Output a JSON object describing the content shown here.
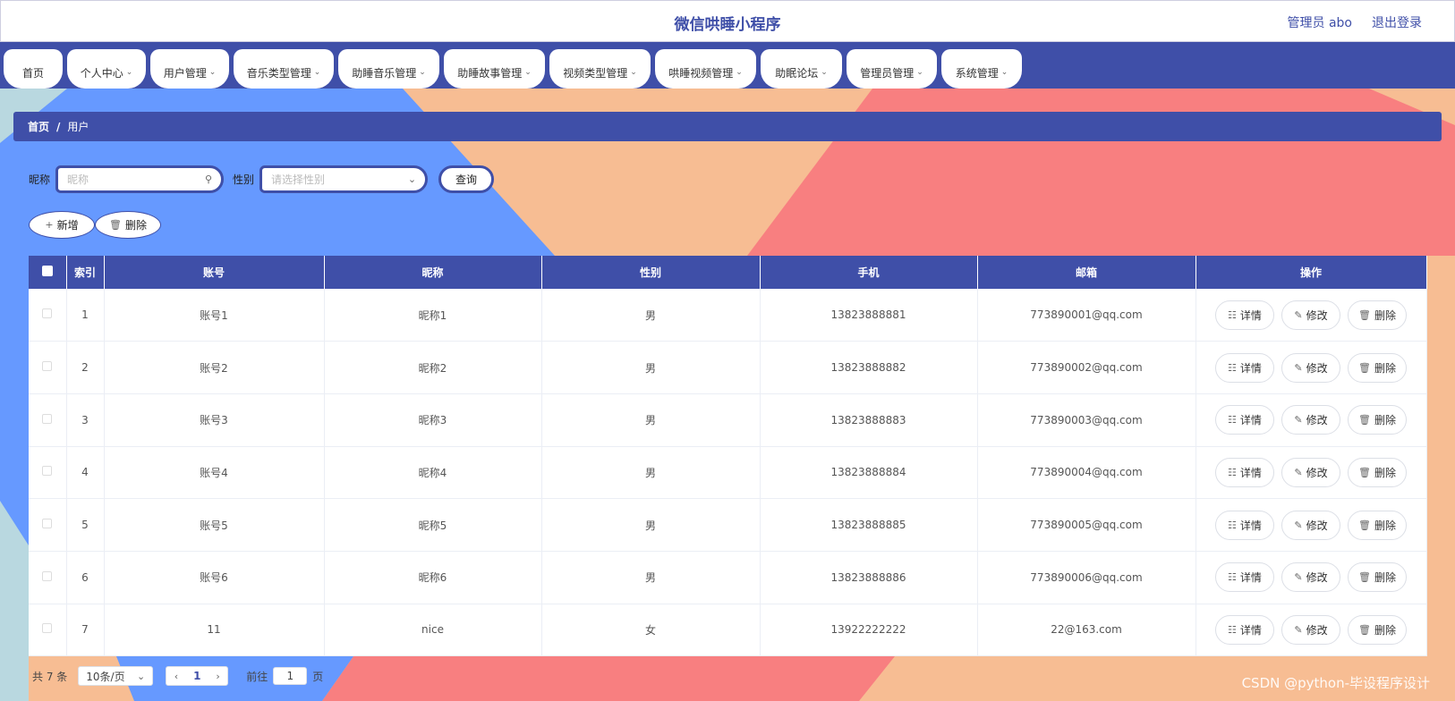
{
  "header": {
    "app_title": "微信哄睡小程序",
    "user_label": "管理员 abo",
    "logout_label": "退出登录"
  },
  "nav": {
    "tabs": [
      {
        "label": "首页",
        "has_dropdown": false
      },
      {
        "label": "个人中心",
        "has_dropdown": true
      },
      {
        "label": "用户管理",
        "has_dropdown": true
      },
      {
        "label": "音乐类型管理",
        "has_dropdown": true
      },
      {
        "label": "助睡音乐管理",
        "has_dropdown": true
      },
      {
        "label": "助睡故事管理",
        "has_dropdown": true
      },
      {
        "label": "视频类型管理",
        "has_dropdown": true
      },
      {
        "label": "哄睡视频管理",
        "has_dropdown": true
      },
      {
        "label": "助眠论坛",
        "has_dropdown": true
      },
      {
        "label": "管理员管理",
        "has_dropdown": true
      },
      {
        "label": "系统管理",
        "has_dropdown": true
      }
    ]
  },
  "breadcrumb": {
    "home": "首页",
    "separator": "/",
    "current": "用户"
  },
  "search": {
    "nickname_label": "昵称",
    "nickname_placeholder": "昵称",
    "gender_label": "性别",
    "gender_placeholder": "请选择性别",
    "query_label": "查询"
  },
  "actions": {
    "add_label": "新增",
    "delete_label": "删除"
  },
  "table": {
    "columns": [
      "索引",
      "账号",
      "昵称",
      "性别",
      "手机",
      "邮箱",
      "操作"
    ],
    "rows": [
      {
        "index": "1",
        "account": "账号1",
        "nickname": "昵称1",
        "gender": "男",
        "phone": "13823888881",
        "email": "773890001@qq.com"
      },
      {
        "index": "2",
        "account": "账号2",
        "nickname": "昵称2",
        "gender": "男",
        "phone": "13823888882",
        "email": "773890002@qq.com"
      },
      {
        "index": "3",
        "account": "账号3",
        "nickname": "昵称3",
        "gender": "男",
        "phone": "13823888883",
        "email": "773890003@qq.com"
      },
      {
        "index": "4",
        "account": "账号4",
        "nickname": "昵称4",
        "gender": "男",
        "phone": "13823888884",
        "email": "773890004@qq.com"
      },
      {
        "index": "5",
        "account": "账号5",
        "nickname": "昵称5",
        "gender": "男",
        "phone": "13823888885",
        "email": "773890005@qq.com"
      },
      {
        "index": "6",
        "account": "账号6",
        "nickname": "昵称6",
        "gender": "男",
        "phone": "13823888886",
        "email": "773890006@qq.com"
      },
      {
        "index": "7",
        "account": "11",
        "nickname": "nice",
        "gender": "女",
        "phone": "13922222222",
        "email": "22@163.com"
      }
    ],
    "row_actions": {
      "detail": "详情",
      "edit": "修改",
      "delete": "删除"
    }
  },
  "pagination": {
    "total_text": "共 7 条",
    "page_size": "10条/页",
    "current_page": "1",
    "goto_label": "前往",
    "goto_value": "1",
    "page_unit": "页"
  },
  "watermark": {
    "text": "CSDN @python-毕设程序设计"
  },
  "colors": {
    "primary": "#3f4fa8",
    "bg_peach": "#f7bd93",
    "bg_blue": "#6699ff",
    "bg_coral": "#f87f80",
    "bg_light": "#b9d8e0"
  }
}
